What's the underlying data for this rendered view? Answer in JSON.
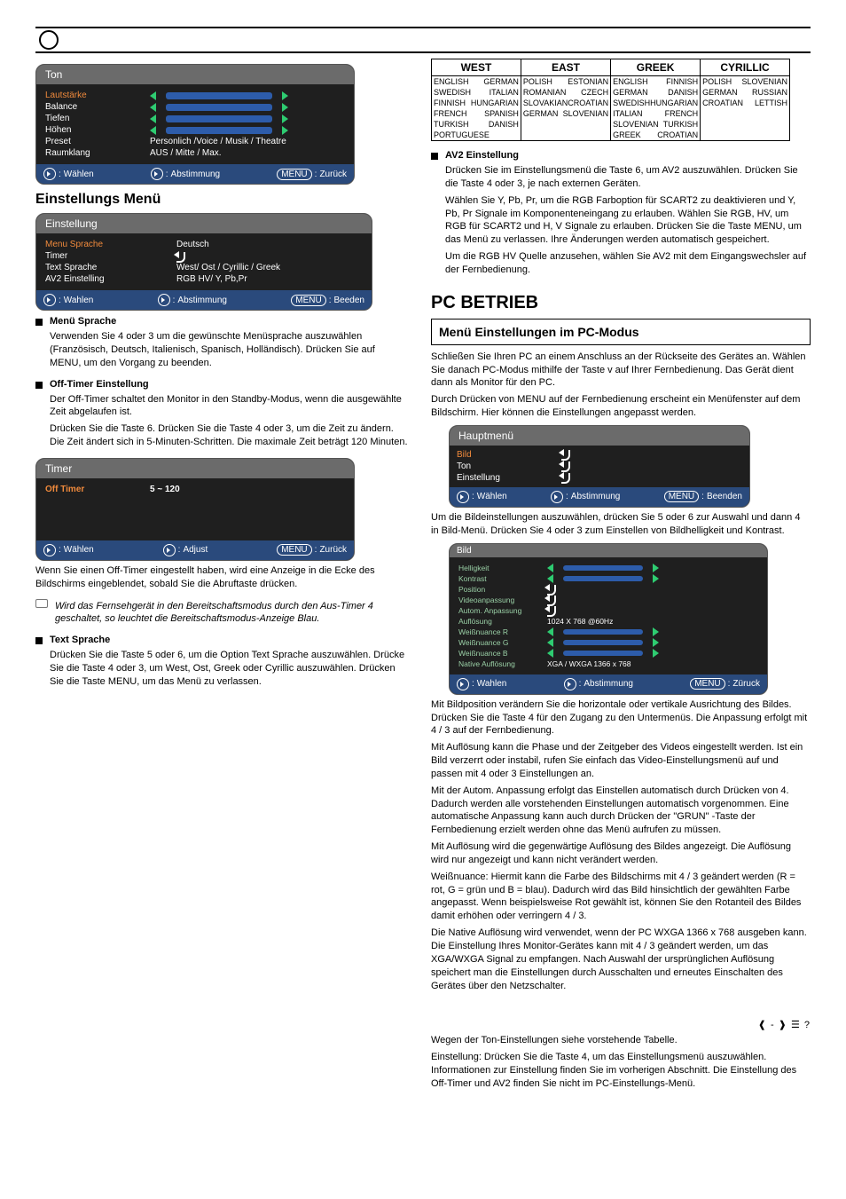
{
  "header": {
    "left": "",
    "right": ""
  },
  "ton": {
    "title": "Ton",
    "rows": [
      {
        "label": "Lautstärke",
        "selected": true,
        "type": "slider"
      },
      {
        "label": "Balance",
        "type": "slider"
      },
      {
        "label": "Tiefen",
        "type": "slider"
      },
      {
        "label": "Höhen",
        "type": "slider"
      },
      {
        "label": "Preset",
        "type": "text",
        "value": "Personlich /Voice / Musik / Theatre"
      },
      {
        "label": "Raumklang",
        "type": "text",
        "value": "AUS / Mitte / Max."
      }
    ],
    "foot_select": "Wählen",
    "foot_adjust": "Abstimmung",
    "foot_back": "Zurück",
    "foot_menu": "MENU"
  },
  "setup_section": {
    "title": "Einstellungs Menü",
    "panel_title": "Einstellung",
    "rows": [
      {
        "label": "Menu Sprache",
        "value": "Deutsch",
        "selected": true
      },
      {
        "label": "Timer",
        "value": "enter"
      },
      {
        "label": "Text  Sprache",
        "value": "West/ Ost / Cyrillic / Greek"
      },
      {
        "label": "AV2  Einstelling",
        "value": "RGB HV/ Y, Pb,Pr"
      }
    ],
    "foot_select": "Wahlen",
    "foot_adjust": "Abstimmung",
    "foot_back": "Beeden",
    "foot_menu": "MENU"
  },
  "menusprache": {
    "heading": "Menü Sprache",
    "text": "Verwenden Sie 4 oder 3 um die gewünschte Menüsprache auszuwählen (Französisch, Deutsch, Italienisch, Spanisch, Holländisch). Drücken Sie auf MENU, um den Vorgang zu beenden."
  },
  "offtimer": {
    "heading": "Off-Timer Einstellung",
    "para": "Der Off-Timer schaltet den Monitor in den Standby-Modus, wenn die ausgewählte Zeit abgelaufen ist.",
    "para2": "Drücken Sie die Taste 6. Drücken Sie die Taste 4 oder 3, um die Zeit zu ändern. Die Zeit ändert sich in 5-Minuten-Schritten. Die maximale Zeit beträgt 120 Minuten.",
    "panel_title": "Timer",
    "row_label": "Off Timer",
    "row_value": "5 ~ 120",
    "foot_select": "Wählen",
    "foot_adjust": "Adjust",
    "foot_back": "Zurück",
    "foot_menu": "MENU",
    "note": "Wenn Sie einen Off-Timer eingestellt haben, wird eine Anzeige in die Ecke des Bildschirms eingeblendet, sobald Sie die Abruftaste drücken.",
    "note2": "Wird das Fernsehgerät in den Bereitschaftsmodus durch den Aus-Timer 4 geschaltet, so leuchtet die Bereitschaftsmodus-Anzeige Blau."
  },
  "textsprache": {
    "heading": "Text Sprache",
    "para": "Drücken Sie die Taste 5 oder 6, um die Option Text Sprache auszuwählen. Drücke Sie die Taste 4 oder 3, um West, Ost, Greek oder Cyrillic auszuwählen. Drücken Sie die Taste MENU, um das Menü zu verlassen."
  },
  "lang_table": {
    "headers": [
      "WEST",
      "EAST",
      "GREEK",
      "CYRILLIC"
    ],
    "rows": [
      [
        [
          "ENGLISH",
          "GERMAN"
        ],
        [
          "POLISH",
          "ESTONIAN"
        ],
        [
          "ENGLISH",
          "FINNISH"
        ],
        [
          "POLISH",
          "SLOVENIAN"
        ]
      ],
      [
        [
          "SWEDISH",
          "ITALIAN"
        ],
        [
          "ROMANIAN",
          "CZECH"
        ],
        [
          "GERMAN",
          "DANISH"
        ],
        [
          "GERMAN",
          "RUSSIAN"
        ]
      ],
      [
        [
          "FINNISH",
          "HUNGARIAN"
        ],
        [
          "SLOVAKIAN",
          "CROATIAN"
        ],
        [
          "SWEDISH",
          "HUNGARIAN"
        ],
        [
          "CROATIAN",
          "LETTISH"
        ]
      ],
      [
        [
          "FRENCH",
          "SPANISH"
        ],
        [
          "GERMAN",
          "SLOVENIAN"
        ],
        [
          "ITALIAN",
          "FRENCH"
        ],
        [
          "",
          ""
        ]
      ],
      [
        [
          "TURKISH",
          "DANISH"
        ],
        [
          "",
          ""
        ],
        [
          "SLOVENIAN",
          "TURKISH"
        ],
        [
          "",
          ""
        ]
      ],
      [
        [
          "PORTUGUESE",
          ""
        ],
        [
          "",
          ""
        ],
        [
          "GREEK",
          "CROATIAN"
        ],
        [
          "",
          ""
        ]
      ]
    ]
  },
  "av2": {
    "heading": "AV2 Einstellung",
    "para": "Drücken Sie im Einstellungsmenü die Taste 6, um AV2 auszuwählen. Drücken Sie die Taste 4 oder 3, je nach externen Geräten.",
    "items": [
      "Wählen Sie Y, Pb, Pr, um die RGB Farboption für SCART2 zu deaktivieren und Y, Pb, Pr Signale im Komponenteneingang zu erlauben. Wählen Sie RGB, HV, um RGB für SCART2 und H, V Signale zu erlauben. Drücken Sie die Taste MENU, um das Menü zu verlassen. Ihre Änderungen werden automatisch gespeichert.",
      "Um die RGB HV Quelle anzusehen, wählen Sie AV2 mit dem Eingangswechsler auf der Fernbedienung."
    ]
  },
  "pc": {
    "big": "PC BETRIEB",
    "sub": "Menü Einstellungen im PC-Modus",
    "para": "Schließen Sie Ihren PC an einem Anschluss an der Rückseite des Gerätes an. Wählen Sie danach PC-Modus mithilfe der Taste v auf Ihrer Fernbedienung. Das Gerät dient dann als Monitor für den PC.",
    "para2": "Durch Drücken von MENU auf der Fernbedienung erscheint ein Menüfenster auf dem Bildschirm. Hier können die Einstellungen angepasst werden.",
    "para3": "Um die Bildeinstellungen auszuwählen, drücken Sie 5 oder 6  zur Auswahl und dann 4 in Bild-Menü. Drücken Sie 4 oder 3 zum Einstellen von Bildhelligkeit und Kontrast.",
    "para4": "Mit Bildposition verändern Sie die horizontale oder vertikale Ausrichtung des Bildes. Drücken Sie die Taste 4 für den Zugang zu den Untermenüs. Die Anpassung erfolgt mit 4 / 3 auf der Fernbedienung.",
    "para5": "Mit Auflösung kann die Phase und der Zeitgeber des Videos eingestellt werden. Ist ein Bild verzerrt oder instabil, rufen Sie einfach das Video-Einstellungsmenü auf und passen mit 4 oder 3 Einstellungen an.",
    "para6": "Mit der Autom. Anpassung erfolgt das Einstellen automatisch durch Drücken von 4. Dadurch werden alle vorstehenden Einstellungen automatisch vorgenommen. Eine automatische Anpassung kann auch durch Drücken der \"GRUN\" -Taste der Fernbedienung erzielt werden ohne das Menü aufrufen zu müssen.",
    "para7": "Mit Auflösung wird die gegenwärtige Auflösung des Bildes angezeigt. Die Auflösung wird nur angezeigt und kann nicht verändert werden.",
    "para8": "Weißnuance: Hiermit kann die Farbe des Bildschirms mit 4 / 3 geändert werden (R = rot, G = grün und B = blau). Dadurch wird das Bild hinsichtlich der gewählten Farbe angepasst. Wenn beispielsweise Rot gewählt ist, können Sie den Rotanteil des Bildes damit erhöhen oder verringern 4 / 3.",
    "para9": "Die Native Auflösung wird verwendet, wenn der PC WXGA 1366 x 768 ausgeben kann. Die Einstellung Ihres Monitor-Gerätes kann mit 4 / 3 geändert werden, um das XGA/WXGA Signal zu empfangen. Nach Auswahl der ursprünglichen Auflösung speichert man die Einstellungen durch Ausschalten und erneutes Einschalten des Gerätes über den Netzschalter.",
    "para10": "Wegen der Ton-Einstellungen siehe vorstehende Tabelle.",
    "para11": "Einstellung: Drücken Sie die Taste 4, um das Einstellungsmenü auszuwählen. Informationen zur Einstellung finden Sie im vorherigen Abschnitt. Die Einstellung des Off-Timer und AV2 finden Sie nicht im PC-Einstellungs-Menü."
  },
  "haupt": {
    "title": "Hauptmenü",
    "rows": [
      {
        "label": "Bild",
        "selected": true
      },
      {
        "label": "Ton"
      },
      {
        "label": "Einstellung"
      }
    ],
    "foot_select": "Wählen",
    "foot_adjust": "Abstimmung",
    "foot_back": "Beenden",
    "foot_menu": "MENU"
  },
  "bildpc": {
    "title": "Bild",
    "rows": [
      {
        "label": "Helligkeit",
        "selected": true,
        "type": "slider"
      },
      {
        "label": "Kontrast",
        "type": "slider"
      },
      {
        "label": "Position",
        "type": "enter"
      },
      {
        "label": "Videoanpassung",
        "type": "enter"
      },
      {
        "label": "Autom. Anpassung",
        "type": "enter"
      },
      {
        "label": "Auflösung",
        "type": "text",
        "value": "1024 X  768        @60Hz"
      },
      {
        "label": "Weißnuance R",
        "type": "slider"
      },
      {
        "label": "Weißnuance G",
        "type": "slider"
      },
      {
        "label": "Weißnuance B",
        "type": "slider"
      },
      {
        "label": "Native Auflösung",
        "type": "text",
        "value": "XGA / WXGA 1366 x 768"
      }
    ],
    "foot_select": "Wahlen",
    "foot_adjust": "Abstimmung",
    "foot_back": "Züruck",
    "foot_menu": "MENU"
  },
  "pagefoot": {
    "glyphs": "❰ - ❱ ☰ ?"
  }
}
